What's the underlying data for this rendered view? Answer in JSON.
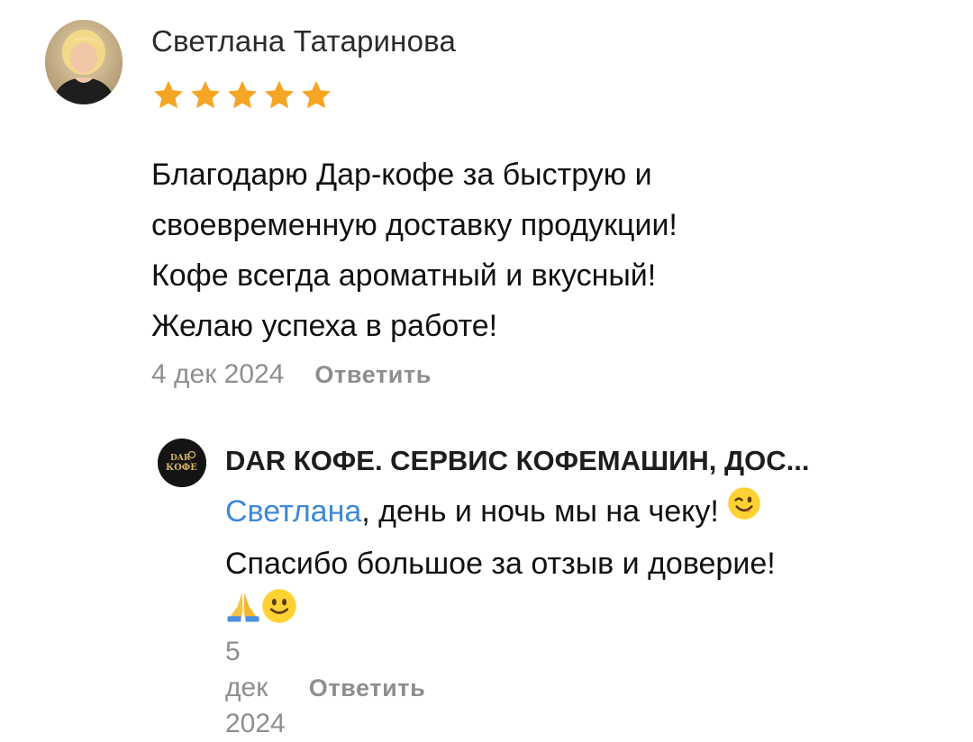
{
  "review": {
    "author": "Светлана Татаринова",
    "rating": 5,
    "rating_max": 5,
    "star_color": "#f5a524",
    "lines": [
      "Благодарю Дар-кофе за быструю и",
      "своевременную доставку продукции!",
      "Кофе всегда ароматный и вкусный!",
      "Желаю успеха в работе!"
    ],
    "date": "4 дек 2024",
    "reply_label": "Ответить"
  },
  "answer": {
    "business_name": "DAR КОФЕ. СЕРВИС КОФЕМАШИН, ДОС...",
    "avatar_logo": {
      "line1": "DAR",
      "line2": "КОФЕ"
    },
    "mention": "Светлана",
    "line1_rest": ", день и ночь мы на чеку!",
    "line2": "Спасибо большое за отзыв и доверие!",
    "emojis": [
      "winking-face",
      "folded-hands",
      "smiling-face"
    ],
    "mention_color": "#3c88d9",
    "date": "5 дек 2024",
    "reply_label": "Ответить"
  }
}
